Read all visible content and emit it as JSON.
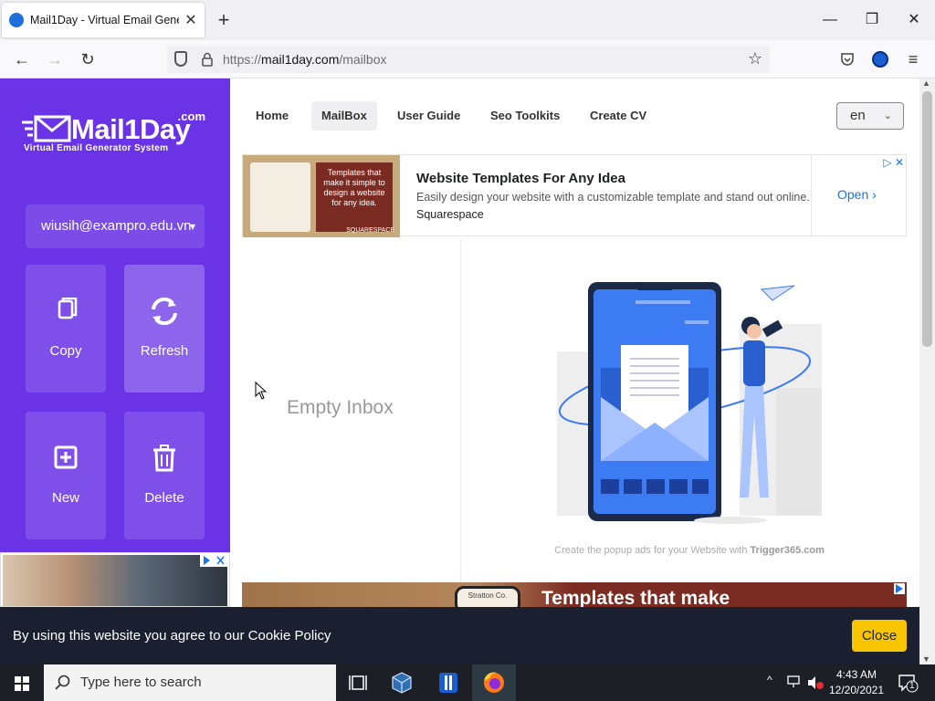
{
  "browser": {
    "tab_title": "Mail1Day - Virtual Email Genera",
    "url_prefix": "https://",
    "url_domain": "mail1day.com",
    "url_path": "/mailbox",
    "new_tab_label": "+",
    "window_controls": {
      "minimize": "—",
      "maximize": "❐",
      "close": "✕"
    }
  },
  "sidebar": {
    "logo": {
      "dotcom": ".com",
      "brand": "Mail1Day",
      "tagline": "Virtual Email Generator System"
    },
    "email": "wiusih@exampro.edu.vn",
    "actions": [
      {
        "label": "Copy",
        "icon": "copy-icon"
      },
      {
        "label": "Refresh",
        "icon": "refresh-icon"
      },
      {
        "label": "New",
        "icon": "plus-square-icon"
      },
      {
        "label": "Delete",
        "icon": "trash-icon"
      }
    ]
  },
  "nav": {
    "items": [
      "Home",
      "MailBox",
      "User Guide",
      "Seo Toolkits",
      "Create CV"
    ],
    "selected": "MailBox",
    "language": "en"
  },
  "ad_top": {
    "thumb_text": "Templates that make it simple to design a website for any idea.",
    "thumb_brand": "SQUARESPACE",
    "headline": "Website Templates For Any Idea",
    "description": "Easily design your website with a customizable template and stand out online.",
    "advertiser": "Squarespace",
    "cta": "Open"
  },
  "inbox": {
    "empty_text": "Empty Inbox",
    "credit_prefix": "Create the popup ads for your Website with ",
    "credit_brand": "Trigger365.com"
  },
  "ad_bottom": {
    "text": "Templates that make",
    "phone_text": "Stratton Co."
  },
  "cookie": {
    "message": "By using this website you agree to our Cookie Policy",
    "button": "Close"
  },
  "taskbar": {
    "search_placeholder": "Type here to search",
    "time": "4:43 AM",
    "date": "12/20/2021",
    "notification_count": "1"
  },
  "colors": {
    "sidebar": "#6a34e6",
    "accent_blue": "#1a73e8",
    "cookie_bg": "#1b2030",
    "cookie_button": "#f7c600"
  }
}
